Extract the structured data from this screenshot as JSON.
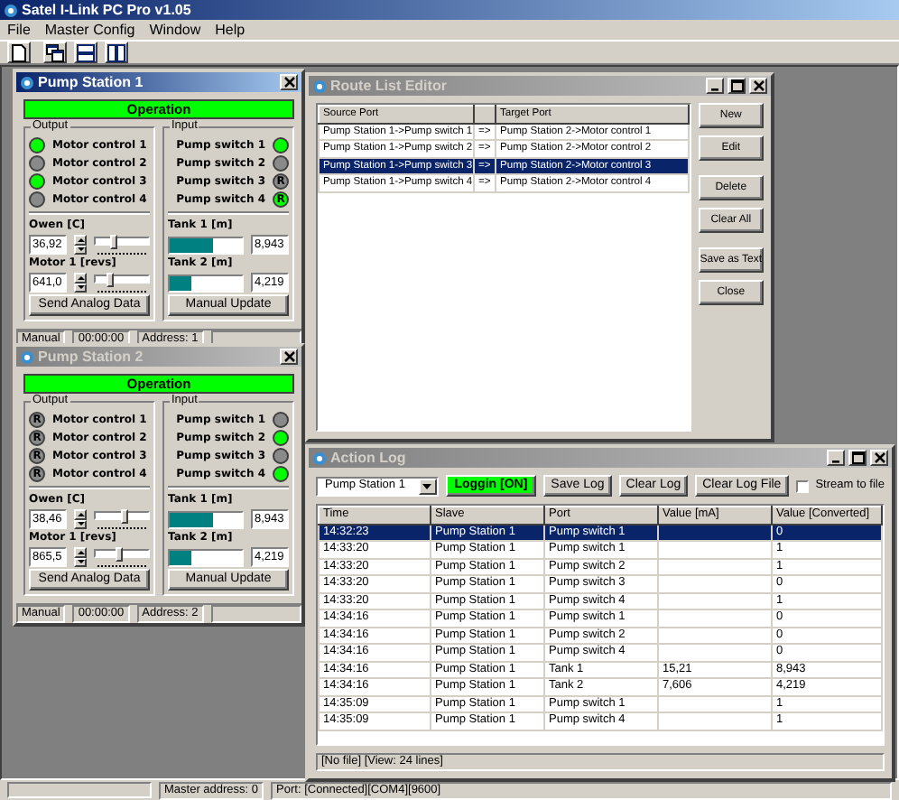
{
  "app": {
    "title": "Satel I-Link PC Pro v1.05"
  },
  "menu": [
    "File",
    "Master Config",
    "Window",
    "Help"
  ],
  "pump_stations": [
    {
      "title": "Pump Station 1",
      "active": true,
      "status": {
        "text": "Operation",
        "on": true
      },
      "output": {
        "legend": "Output",
        "items": [
          {
            "label": "Motor control 1",
            "on": true
          },
          {
            "label": "Motor control 2",
            "on": false
          },
          {
            "label": "Motor control 3",
            "on": true
          },
          {
            "label": "Motor control 4",
            "on": false
          }
        ]
      },
      "input": {
        "legend": "Input",
        "items": [
          {
            "label": "Pump switch 1",
            "on": true
          },
          {
            "label": "Pump switch 2",
            "on": false
          },
          {
            "label": "Pump switch 3",
            "on": false,
            "mark": "R"
          },
          {
            "label": "Pump switch 4",
            "on": true,
            "mark": "R"
          }
        ]
      },
      "analog": [
        {
          "label": "Owen [C]",
          "value": "36,92",
          "level": 0.35
        },
        {
          "label": "Motor 1 [revs]",
          "value": "641,0",
          "level": 0.3
        }
      ],
      "tanks": [
        {
          "label": "Tank 1 [m]",
          "value": "8,943",
          "level": 0.6
        },
        {
          "label": "Tank 2 [m]",
          "value": "4,219",
          "level": 0.3
        }
      ],
      "send_button": "Send Analog Data",
      "update_button": "Manual Update",
      "status_fields": [
        "Manual",
        "00:00:00",
        "Address: 1"
      ]
    },
    {
      "title": "Pump Station 2",
      "active": false,
      "status": {
        "text": "Operation",
        "on": true
      },
      "output": {
        "legend": "Output",
        "items": [
          {
            "label": "Motor control 1",
            "on": false,
            "mark": "R"
          },
          {
            "label": "Motor control 2",
            "on": false,
            "mark": "R"
          },
          {
            "label": "Motor control 3",
            "on": false,
            "mark": "R"
          },
          {
            "label": "Motor control 4",
            "on": false,
            "mark": "R"
          }
        ]
      },
      "input": {
        "legend": "Input",
        "items": [
          {
            "label": "Pump switch 1",
            "on": false
          },
          {
            "label": "Pump switch 2",
            "on": true
          },
          {
            "label": "Pump switch 3",
            "on": false
          },
          {
            "label": "Pump switch 4",
            "on": true
          }
        ]
      },
      "analog": [
        {
          "label": "Owen [C]",
          "value": "38,46",
          "level": 0.55
        },
        {
          "label": "Motor 1 [revs]",
          "value": "865,5",
          "level": 0.45
        }
      ],
      "tanks": [
        {
          "label": "Tank 1 [m]",
          "value": "8,943",
          "level": 0.6
        },
        {
          "label": "Tank 2 [m]",
          "value": "4,219",
          "level": 0.3
        }
      ],
      "send_button": "Send Analog Data",
      "update_button": "Manual Update",
      "status_fields": [
        "Manual",
        "00:00:00",
        "Address: 2"
      ]
    }
  ],
  "route_list_editor": {
    "title": "Route List Editor",
    "active": false,
    "columns": {
      "source": "Source Port",
      "target": "Target Port"
    },
    "rows": [
      {
        "source": "Pump Station 1->Pump switch 1",
        "arrow": "=>",
        "target": "Pump Station 2->Motor control 1",
        "selected": false
      },
      {
        "source": "Pump Station 1->Pump switch 2",
        "arrow": "=>",
        "target": "Pump Station 2->Motor control 2",
        "selected": false
      },
      {
        "source": "Pump Station 1->Pump switch 3",
        "arrow": "=>",
        "target": "Pump Station 2->Motor control 3",
        "selected": true
      },
      {
        "source": "Pump Station 1->Pump switch 4",
        "arrow": "=>",
        "target": "Pump Station 2->Motor control 4",
        "selected": false
      }
    ],
    "button_groups": [
      [
        "New",
        "Edit"
      ],
      [
        "Delete",
        "Clear All"
      ],
      [
        "Save as Text",
        "Close"
      ]
    ]
  },
  "action_log": {
    "title": "Action Log",
    "active": false,
    "slave_select": "Pump Station 1",
    "logging_button": {
      "label": "Loggin [ON]",
      "on": true
    },
    "buttons": [
      "Save Log",
      "Clear Log",
      "Clear Log File"
    ],
    "stream_checkbox": {
      "label": "Stream to file",
      "checked": false
    },
    "columns": [
      "Time",
      "Slave",
      "Port",
      "Value [mA]",
      "Value [Converted]"
    ],
    "rows": [
      {
        "time": "14:32:23",
        "slave": "Pump Station 1",
        "port": "Pump switch 1",
        "value_converted": "0",
        "selected": true
      },
      {
        "time": "14:33:20",
        "slave": "Pump Station 1",
        "port": "Pump switch 1",
        "value_converted": "1",
        "selected": false
      },
      {
        "time": "14:33:20",
        "slave": "Pump Station 1",
        "port": "Pump switch 2",
        "value_converted": "1",
        "selected": false
      },
      {
        "time": "14:33:20",
        "slave": "Pump Station 1",
        "port": "Pump switch 3",
        "value_converted": "0",
        "selected": false
      },
      {
        "time": "14:33:20",
        "slave": "Pump Station 1",
        "port": "Pump switch 4",
        "value_converted": "1",
        "selected": false
      },
      {
        "time": "14:34:16",
        "slave": "Pump Station 1",
        "port": "Pump switch 1",
        "value_converted": "0",
        "selected": false
      },
      {
        "time": "14:34:16",
        "slave": "Pump Station 1",
        "port": "Pump switch 2",
        "value_converted": "0",
        "selected": false
      },
      {
        "time": "14:34:16",
        "slave": "Pump Station 1",
        "port": "Pump switch 4",
        "value_converted": "0",
        "selected": false
      },
      {
        "time": "14:34:16",
        "slave": "Pump Station 1",
        "port": "Tank 1",
        "value_ma": "15,21",
        "value_converted": "8,943",
        "selected": false
      },
      {
        "time": "14:34:16",
        "slave": "Pump Station 1",
        "port": "Tank 2",
        "value_ma": "7,606",
        "value_converted": "4,219",
        "selected": false
      },
      {
        "time": "14:35:09",
        "slave": "Pump Station 1",
        "port": "Pump switch 1",
        "value_converted": "1",
        "selected": false
      },
      {
        "time": "14:35:09",
        "slave": "Pump Station 1",
        "port": "Pump switch 4",
        "value_converted": "1",
        "selected": false
      }
    ],
    "status": "[No file] [View: 24 lines]"
  },
  "status_bar": [
    "Master address: 0",
    "Port: [Connected][COM4][9600]"
  ]
}
